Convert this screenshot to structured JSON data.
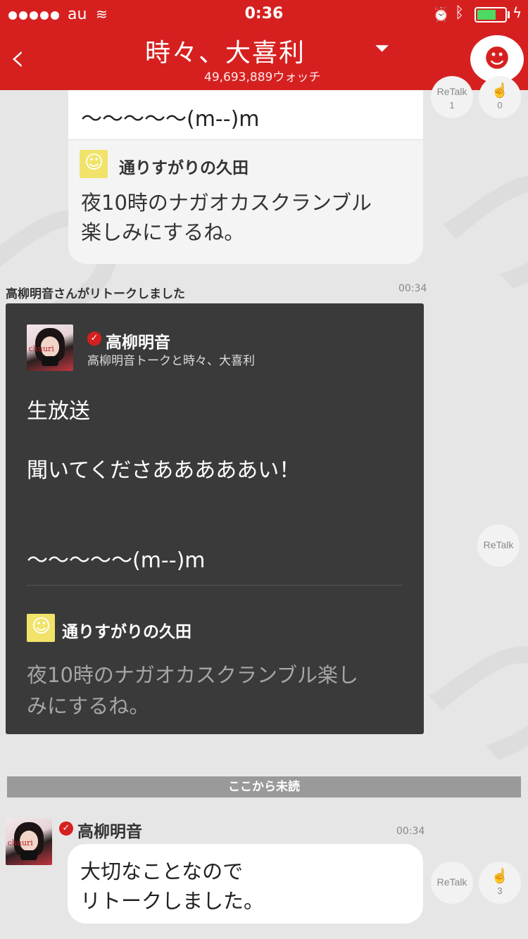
{
  "status_bar": {
    "carrier": "au",
    "time": "0:36"
  },
  "nav": {
    "title": "時々、大喜利",
    "watch_count": "49,693,889ウォッチ"
  },
  "top_card": {
    "text": "〜〜〜〜〜(m--)m",
    "retalk_label": "ReTalk",
    "retalk_count": "1",
    "clap_count": "0",
    "quote": {
      "author": "通りすがりの久田",
      "text_line1": "夜10時のナガオカスクランブル",
      "text_line2": "楽しみにするね。"
    }
  },
  "retalk_notice": {
    "text": "高柳明音さんがリトークしました",
    "time": "00:34"
  },
  "retalk_card": {
    "author": "高柳明音",
    "subtitle": "高柳明音トークと時々、大喜利",
    "avatar_word": "chuuri",
    "line1": "生放送",
    "line2": "聞いてくださあああああい！",
    "line3": "〜〜〜〜〜(m--)m",
    "retalk_label": "ReTalk",
    "quote": {
      "author": "通りすがりの久田",
      "text_line1": "夜10時のナガオカスクランブル楽し",
      "text_line2": "みにするね。"
    }
  },
  "unread_divider": "ここから未読",
  "message": {
    "author": "高柳明音",
    "time": "00:34",
    "line1": "大切なことなので",
    "line2": "リトークしました。",
    "avatar_word": "chuuri",
    "retalk_label": "ReTalk",
    "clap_count": "3"
  },
  "colors": {
    "brand_red": "#d62020",
    "background": "#e6e6e6",
    "dark_card": "#3a3a3a"
  }
}
